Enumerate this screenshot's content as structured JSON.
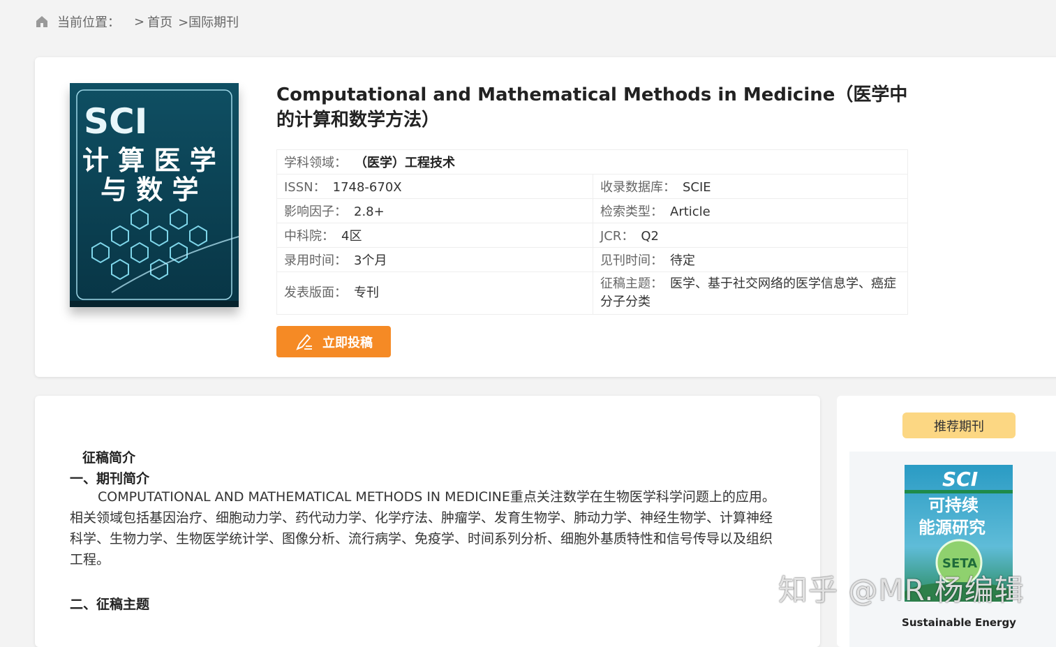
{
  "breadcrumb": {
    "location_label": "当前位置：",
    "sep": ">",
    "home": "首页",
    "current": ">国际期刊"
  },
  "journal": {
    "title": "Computational and Mathematical Methods in Medicine（医学中的计算和数学方法）",
    "cover": {
      "badge": "SCI",
      "line1": "计 算 医 学",
      "line2": "与 数 学"
    },
    "fields": {
      "subject_label": "学科领域：",
      "subject_value": "（医学）工程技术",
      "issn_label": "ISSN：",
      "issn_value": "1748-670X",
      "database_label": "收录数据库：",
      "database_value": "SCIE",
      "impact_label": "影响因子：",
      "impact_value": "2.8+",
      "search_type_label": "检索类型：",
      "search_type_value": "Article",
      "cas_label": "中科院：",
      "cas_value": "4区",
      "jcr_label": "JCR：",
      "jcr_value": "Q2",
      "accept_label": "录用时间：",
      "accept_value": "3个月",
      "publish_time_label": "见刊时间：",
      "publish_time_value": "待定",
      "layout_label": "发表版面：",
      "layout_value": "专刊",
      "topics_label": "征稿主题：",
      "topics_value": "医学、基于社交网络的医学信息学、癌症分子分类"
    },
    "submit_label": "立即投稿"
  },
  "main": {
    "section_title": "征稿简介",
    "intro_heading": "一、期刊简介",
    "intro_text": "COMPUTATIONAL AND MATHEMATICAL METHODS IN MEDICINE重点关注数学在生物医学科学问题上的应用。相关领域包括基因治疗、细胞动力学、药代动力学、化学疗法、肿瘤学、发育生物学、肺动力学、神经生物学、计算神经科学、生物力学、生物医学统计学、图像分析、流行病学、免疫学、时间系列分析、细胞外基质特性和信号传导以及组织工程。",
    "topics_heading": "二、征稿主题"
  },
  "sidebar": {
    "recommend_label": "推荐期刊",
    "rec_cover": {
      "badge": "SCI",
      "line1": "可持续",
      "line2": "能源研究",
      "logo": "SETA"
    },
    "rec_caption": "Sustainable Energy"
  },
  "watermark": "知乎 @MR.杨编辑",
  "colors": {
    "accent": "#f58a25",
    "recommend": "#fcd783",
    "cover_bg": "#0d4a5c"
  }
}
